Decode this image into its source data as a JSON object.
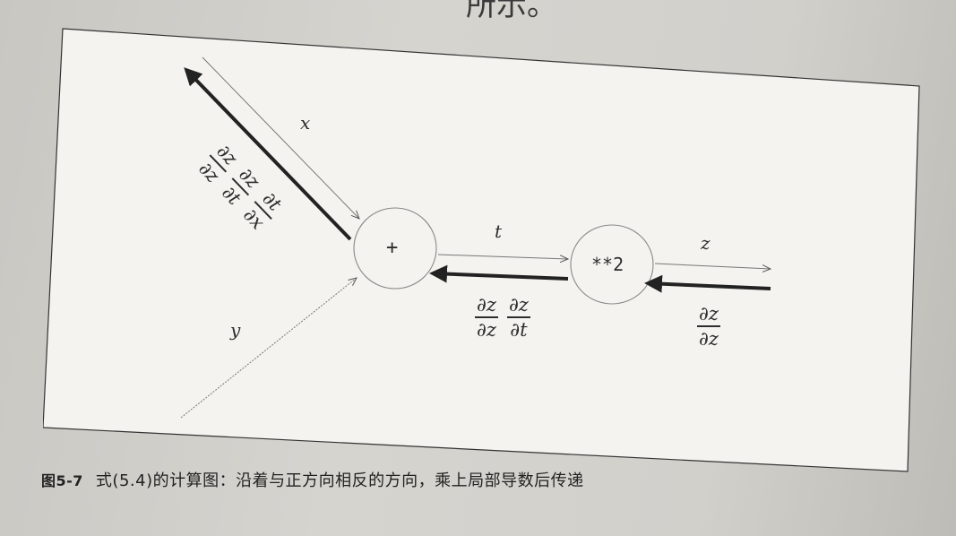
{
  "figure": {
    "edge_labels": {
      "x": "x",
      "y": "y",
      "t": "t",
      "z": "z"
    },
    "nodes": {
      "add": "+",
      "square": "**2"
    },
    "backprop_fractions": {
      "x_path": [
        {
          "num": "∂z",
          "den": "∂z"
        },
        {
          "num": "∂z",
          "den": "∂t"
        },
        {
          "num": "∂t",
          "den": "∂x"
        }
      ],
      "t_path": [
        {
          "num": "∂z",
          "den": "∂z"
        },
        {
          "num": "∂z",
          "den": "∂t"
        }
      ],
      "z_path": [
        {
          "num": "∂z",
          "den": "∂z"
        }
      ]
    }
  },
  "caption": {
    "number": "图5-7",
    "text": "式(5.4)的计算图：沿着与正方向相反的方向，乘上局部导数后传递"
  },
  "header_fragment": "所示。"
}
